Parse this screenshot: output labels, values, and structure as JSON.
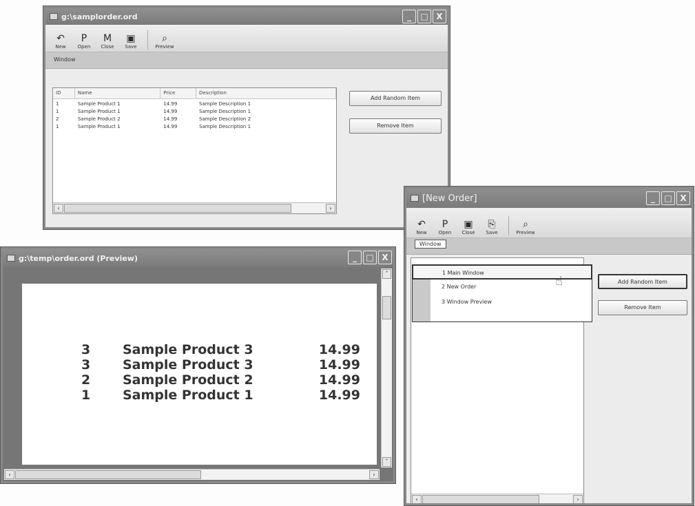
{
  "win1": {
    "title": "g:\\samplorder.ord",
    "winbtns": [
      "_",
      "□",
      "X"
    ],
    "toolbar": [
      {
        "icon": "new-icon",
        "glyph": "↶",
        "label": "New"
      },
      {
        "icon": "open-icon",
        "glyph": "P",
        "label": "Open"
      },
      {
        "icon": "close-icon",
        "glyph": "M",
        "label": "Close"
      },
      {
        "icon": "save-icon",
        "glyph": "▣",
        "label": "Save"
      },
      {
        "icon": "preview-icon",
        "glyph": "⌕",
        "label": "Preview"
      }
    ],
    "menu_label": "Window",
    "columns": [
      "ID",
      "Name",
      "Price",
      "Description"
    ],
    "rows": [
      [
        "1",
        "Sample Product 1",
        "14.99",
        "Sample Description 1"
      ],
      [
        "1",
        "Sample Product 1",
        "14.99",
        "Sample Description 1"
      ],
      [
        "2",
        "Sample Product 2",
        "14.99",
        "Sample Description 2"
      ],
      [
        "1",
        "Sample Product 1",
        "14.99",
        "Sample Description 1"
      ]
    ],
    "add_button": "Add Random Item",
    "remove_button": "Remove Item"
  },
  "win2": {
    "title": "g:\\temp\\order.ord (Preview)",
    "winbtns": [
      "_",
      "□",
      "X"
    ],
    "rows": [
      {
        "id": "3",
        "name": "Sample Product 3",
        "price": "14.99"
      },
      {
        "id": "3",
        "name": "Sample Product 3",
        "price": "14.99"
      },
      {
        "id": "2",
        "name": "Sample Product 2",
        "price": "14.99"
      },
      {
        "id": "1",
        "name": "Sample Product 1",
        "price": "14.99"
      }
    ]
  },
  "win3": {
    "title": "[New Order]",
    "winbtns": [
      "_",
      "□",
      "X"
    ],
    "toolbar": [
      {
        "icon": "new-icon",
        "glyph": "↶",
        "label": "New"
      },
      {
        "icon": "open-icon",
        "glyph": "P",
        "label": "Open"
      },
      {
        "icon": "close-icon",
        "glyph": "▣",
        "label": "Close"
      },
      {
        "icon": "save-icon",
        "glyph": "⎘",
        "label": "Save"
      },
      {
        "icon": "preview-icon",
        "glyph": "⌕",
        "label": "Preview"
      }
    ],
    "menu_label": "Window",
    "dropdown": [
      "1 Main Window",
      "2 New Order",
      "3 Window Preview"
    ],
    "add_button": "Add Random Item",
    "remove_button": "Remove Item"
  }
}
